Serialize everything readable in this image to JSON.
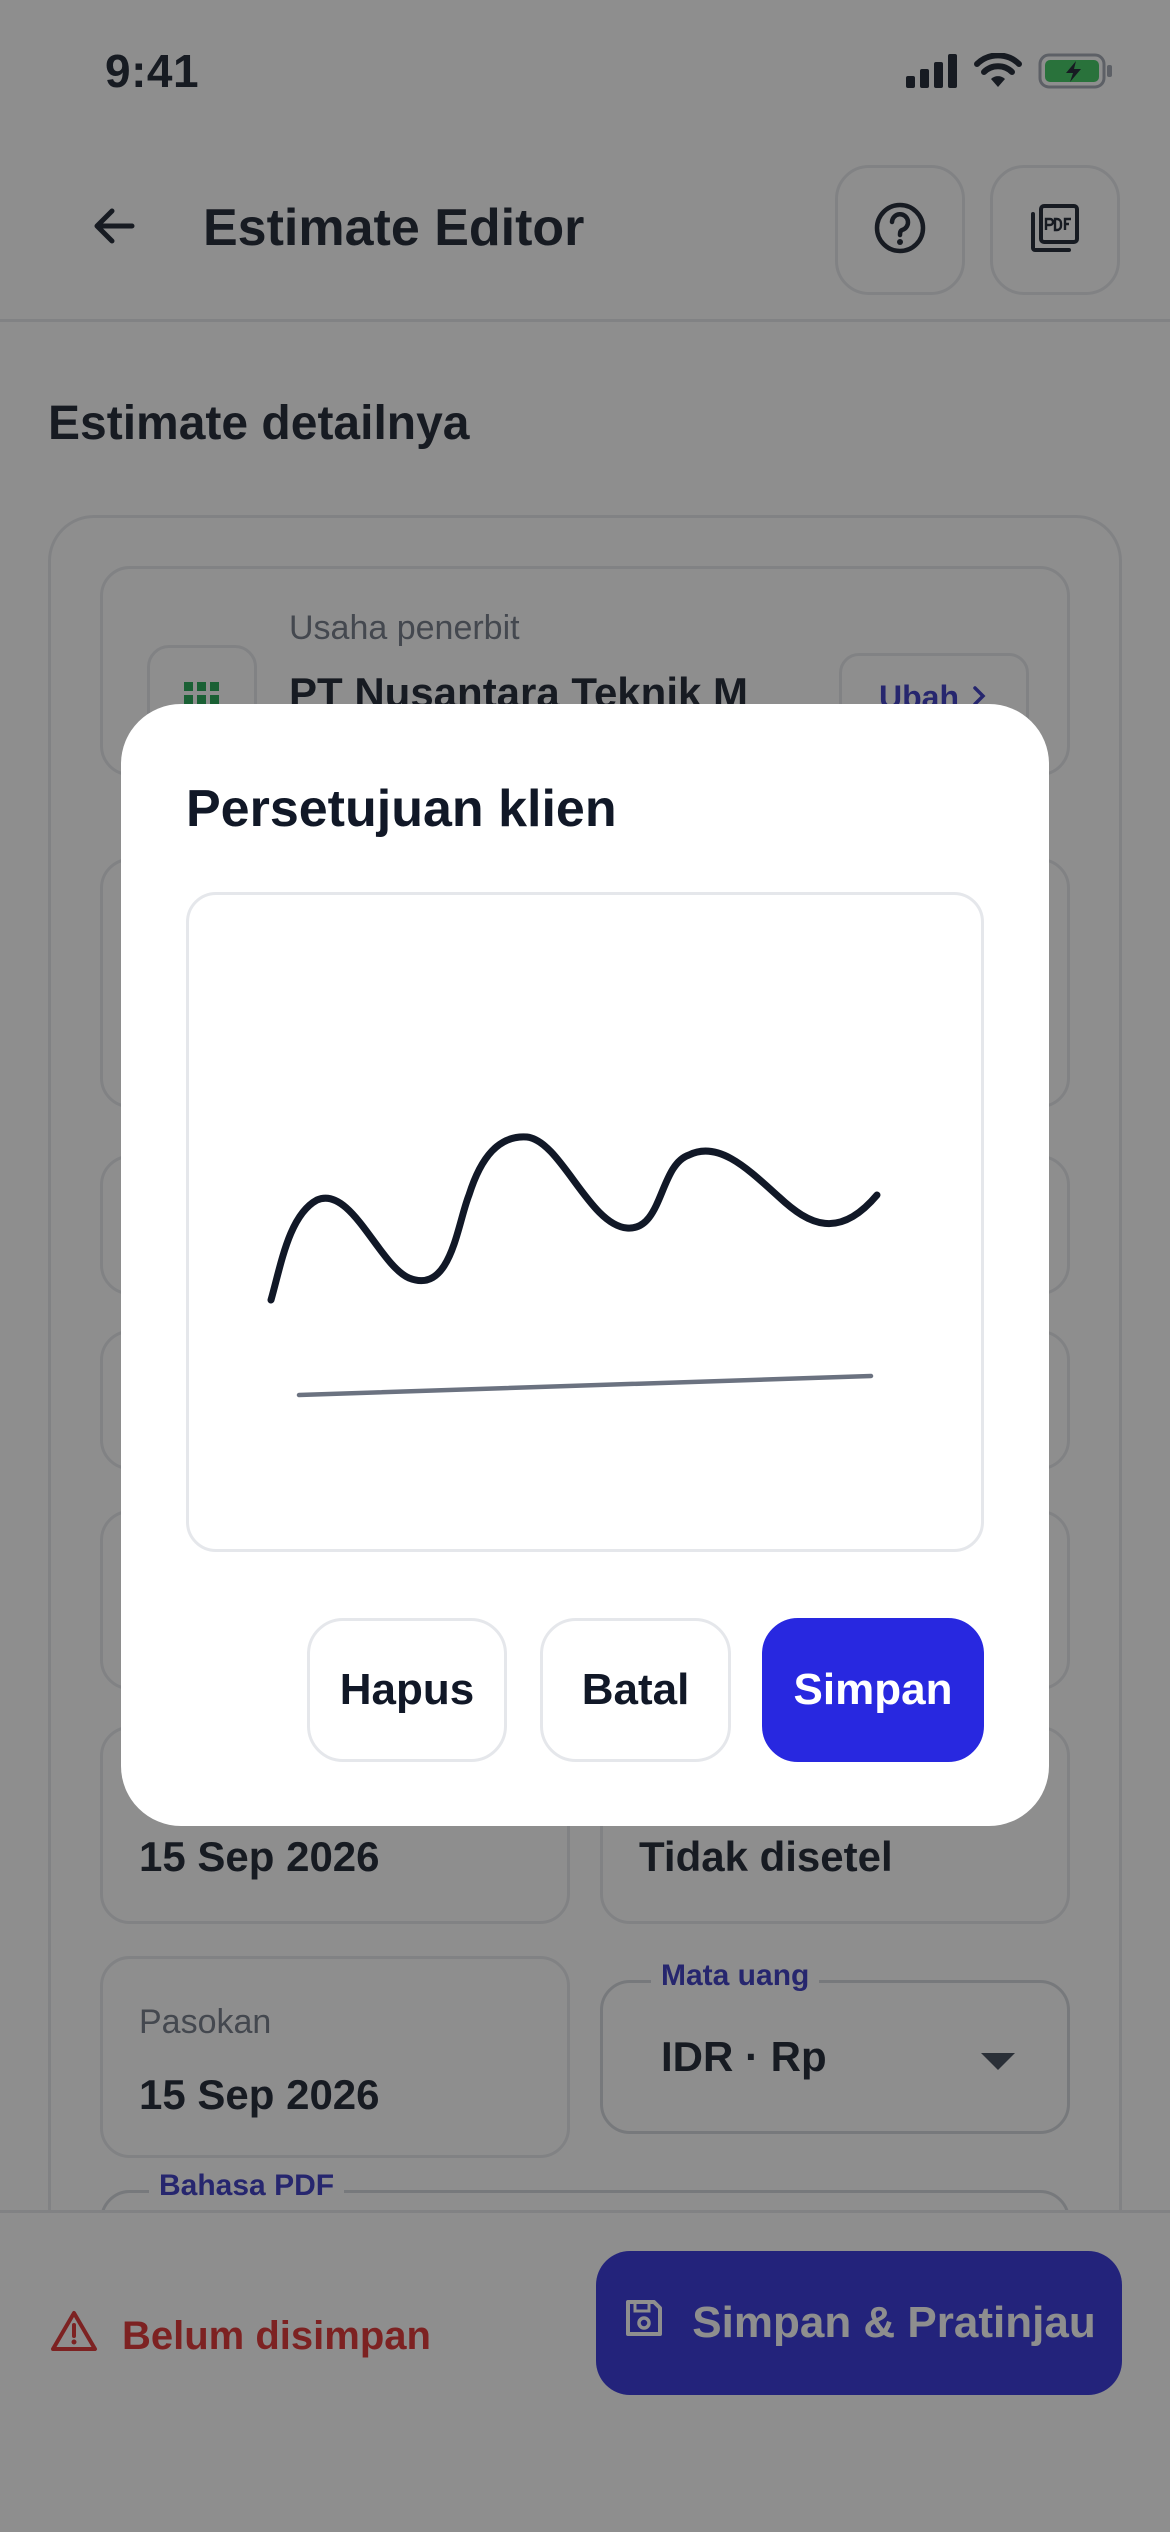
{
  "status_bar": {
    "time": "9:41",
    "icons": [
      "signal-icon",
      "wifi-icon",
      "battery-charging-icon"
    ]
  },
  "app_bar": {
    "title": "Estimate Editor",
    "back_icon": "arrow-left-icon",
    "help_icon": "help-circle-icon",
    "pdf_icon": "pdf-file-icon"
  },
  "section": {
    "title": "Estimate detailnya"
  },
  "issuer": {
    "label": "Usaha penerbit",
    "value": "PT Nusantara Teknik M",
    "change_label": "Ubah",
    "icon": "grid-icon"
  },
  "dates": {
    "due_value": "15 Sep 2026",
    "reminder_value": "Tidak disetel",
    "supply_label": "Pasokan",
    "supply_value": "15 Sep 2026"
  },
  "currency": {
    "label": "Mata uang",
    "value": "IDR · Rp"
  },
  "pdf_language": {
    "label": "Bahasa PDF"
  },
  "bottom_bar": {
    "unsaved_label": "Belum disimpan",
    "save_preview_label": "Simpan & Pratinjau"
  },
  "dialog": {
    "title": "Persetujuan klien",
    "clear_label": "Hapus",
    "cancel_label": "Batal",
    "save_label": "Simpan"
  },
  "colors": {
    "accent": "#2828e0",
    "danger": "#dc2626",
    "ink": "#111827"
  }
}
